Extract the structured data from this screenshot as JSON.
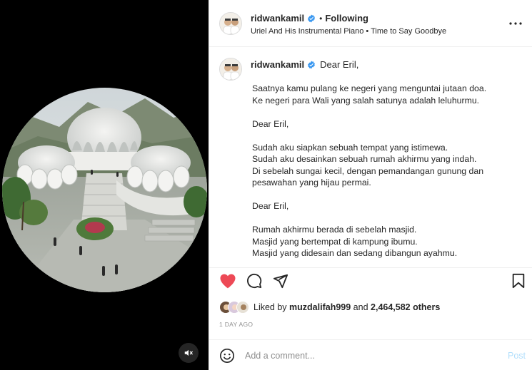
{
  "post": {
    "username": "ridwankamil",
    "separator": "•",
    "follow_status": "Following",
    "audio": "Uriel And His Instrumental Piano • Time to Say Goodbye",
    "caption_first": "Dear Eril,",
    "caption_lines": [
      "Saatnya kamu pulang ke negeri yang menguntai jutaan doa.",
      "Ke negeri para Wali yang salah satunya adalah leluhurmu.",
      "",
      "Dear Eril,",
      "",
      "Sudah aku siapkan sebuah tempat yang istimewa.",
      "Sudah aku desainkan sebuah rumah akhirmu yang indah.",
      "Di sebelah sungai kecil, dengan pemandangan gunung dan",
      "pesawahan yang hijau permai.",
      "",
      "Dear Eril,",
      "",
      "Rumah akhirmu berada di sebelah masjid.",
      "Masjid yang bertempat di kampung ibumu.",
      "Masjid yang didesain dan sedang dibangun ayahmu."
    ],
    "likes_prefix": "Liked by",
    "liked_by_user": "muzdalifah999",
    "likes_and": "and",
    "likes_others": "2,464,582 others",
    "time_ago": "1 DAY AGO"
  },
  "comment": {
    "placeholder": "Add a comment...",
    "post_label": "Post"
  },
  "icons": {
    "media_mute": "speaker-muted-icon",
    "verified": "verified-badge-icon",
    "more": "more-options-icon",
    "like": "heart-filled-icon",
    "comment": "comment-bubble-icon",
    "share": "paper-plane-icon",
    "save": "bookmark-icon",
    "emoji": "smiley-icon"
  },
  "colors": {
    "like_red": "#ed4956",
    "verified_blue": "#3897f0",
    "post_disabled": "#b2dffc",
    "muted_text": "#8e8e8e",
    "text": "#262626"
  }
}
